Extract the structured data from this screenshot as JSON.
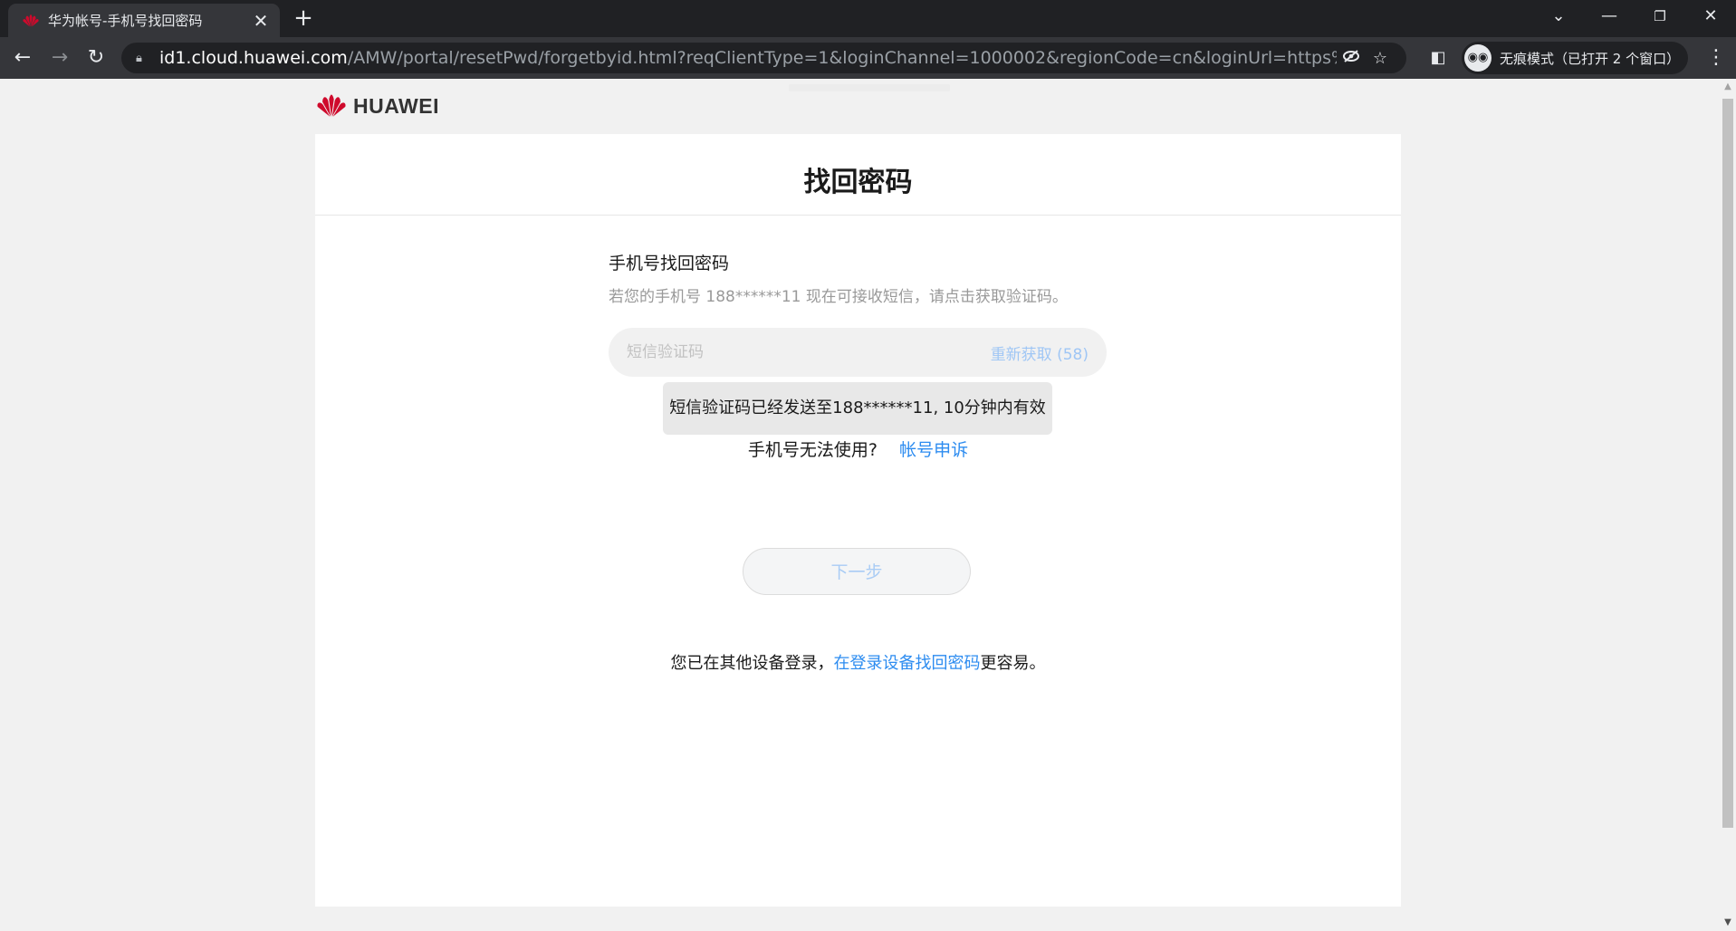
{
  "browser": {
    "tab": {
      "title": "华为帐号-手机号找回密码"
    },
    "address": {
      "host": "id1.cloud.huawei.com",
      "path": "/AMW/portal/resetPwd/forgetbyid.html?reqClientType=1&loginChannel=1000002&regionCode=cn&loginUrl=https%3A%2F%2Fcl..."
    },
    "incognito_label": "无痕模式（已打开 2 个窗口）",
    "icons": {
      "back": "arrow-left-icon",
      "forward": "arrow-right-icon",
      "reload": "reload-icon",
      "lock": "lock-icon",
      "eye_off": "eye-off-icon",
      "bookmark": "star-icon",
      "side_panel": "side-panel-icon",
      "incognito": "incognito-icon",
      "menu": "kebab-menu-icon"
    }
  },
  "page": {
    "brand": "HUAWEI",
    "title": "找回密码",
    "section_title": "手机号找回密码",
    "hint": "若您的手机号 188******11 现在可接收短信，请点击获取验证码。",
    "code_input": {
      "placeholder": "短信验证码",
      "value": ""
    },
    "resend": "重新获取 (58)",
    "toast": "短信验证码已经发送至188******11, 10分钟内有效",
    "no_phone": {
      "text": "手机号无法使用?",
      "link": "帐号申诉"
    },
    "next_button": "下一步",
    "other_device": {
      "before": "您已在其他设备登录，",
      "link": "在登录设备找回密码",
      "after": "更容易。"
    }
  },
  "colors": {
    "brand_red": "#cf0a2c",
    "link": "#2d8cf0",
    "disabled_link": "#9fc6f5"
  }
}
